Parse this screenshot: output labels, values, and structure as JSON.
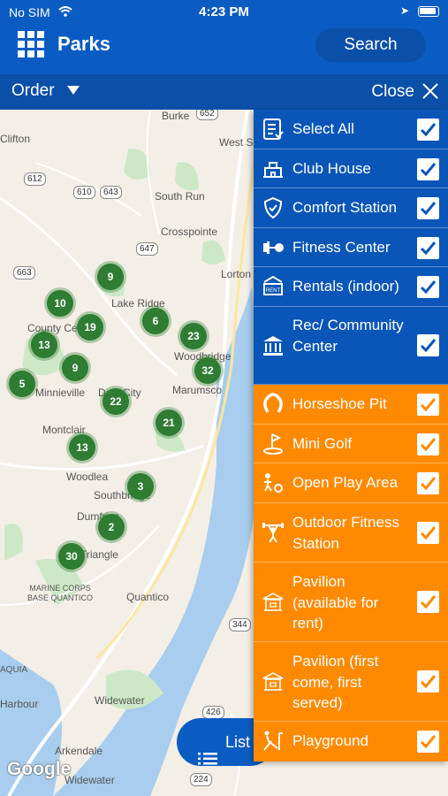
{
  "status": {
    "carrier": "No SIM",
    "time": "4:23 PM"
  },
  "header": {
    "title": "Parks",
    "search_label": "Search"
  },
  "filter_bar": {
    "order_label": "Order",
    "close_label": "Close"
  },
  "map": {
    "labels": [
      "Burke",
      "Clifton",
      "West Springfield",
      "South Run",
      "Crosspointe",
      "Lorton",
      "Lake Ridge",
      "County Center",
      "Woodbridge",
      "Minnieville",
      "Dale City",
      "Marumsco",
      "Montclair",
      "Woodlea",
      "Southbridge",
      "Dumfries",
      "Triangle",
      "Quantico",
      "MARINE CORPS BASE QUANTICO",
      "AQUIA",
      "Widewater",
      "Arkendale",
      "Harbour",
      "Widewater"
    ],
    "shields": [
      "652",
      "612",
      "610",
      "643",
      "663",
      "647",
      "344",
      "426",
      "224"
    ],
    "clusters": [
      "9",
      "10",
      "6",
      "19",
      "23",
      "13",
      "9",
      "32",
      "5",
      "22",
      "21",
      "13",
      "3",
      "2",
      "30"
    ],
    "attribution": "Google"
  },
  "list_button": {
    "label": "List"
  },
  "amenities": [
    {
      "label": "Select All",
      "icon": "list-check-icon",
      "checked": true,
      "group": "blue"
    },
    {
      "label": "Club House",
      "icon": "building-icon",
      "checked": true,
      "group": "blue"
    },
    {
      "label": "Comfort Station",
      "icon": "shield-icon",
      "checked": true,
      "group": "blue"
    },
    {
      "label": "Fitness Center",
      "icon": "dumbbell-icon",
      "checked": true,
      "group": "blue"
    },
    {
      "label": "Rentals (indoor)",
      "icon": "rent-sign-icon",
      "checked": true,
      "group": "blue"
    },
    {
      "label": "Rec/ Community Center",
      "icon": "columns-building-icon",
      "checked": true,
      "group": "blue"
    },
    {
      "label": "Horseshoe Pit",
      "icon": "horseshoe-icon",
      "checked": true,
      "group": "orange"
    },
    {
      "label": "Mini Golf",
      "icon": "mini-golf-icon",
      "checked": true,
      "group": "orange"
    },
    {
      "label": "Open Play Area",
      "icon": "open-play-icon",
      "checked": true,
      "group": "orange"
    },
    {
      "label": "Outdoor Fitness Station",
      "icon": "weightlifter-icon",
      "checked": true,
      "group": "orange"
    },
    {
      "label": "Pavilion (available for rent)",
      "icon": "pavilion-icon",
      "checked": true,
      "group": "orange"
    },
    {
      "label": "Pavilion (first come, first served)",
      "icon": "pavilion-icon",
      "checked": true,
      "group": "orange"
    },
    {
      "label": "Playground",
      "icon": "playground-icon",
      "checked": true,
      "group": "orange"
    }
  ],
  "colors": {
    "header_blue": "#0b5cc2",
    "panel_blue": "#0a56b8",
    "panel_orange": "#ff8a00",
    "cluster_green": "#2e7d32",
    "water": "#a8cdee",
    "park": "#cde8c7"
  }
}
